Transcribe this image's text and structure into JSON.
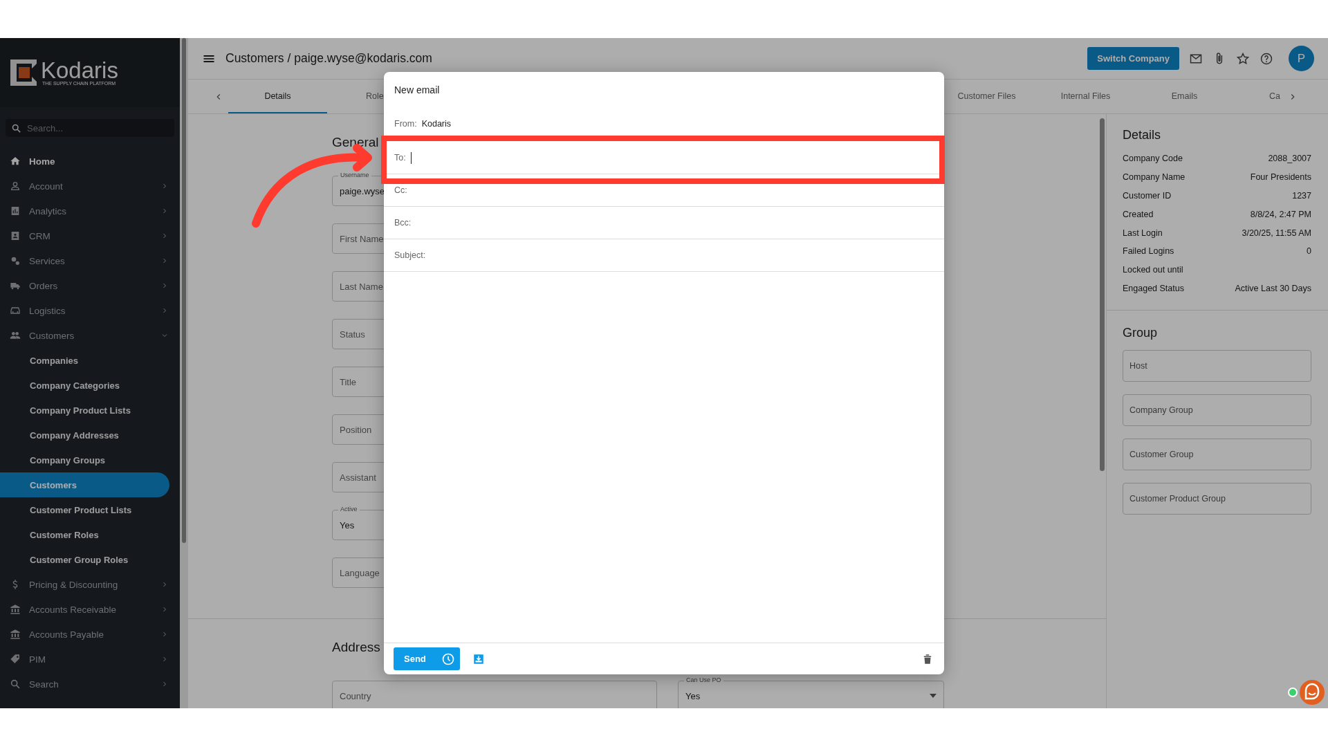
{
  "sidebar": {
    "logo": {
      "name": "Kodaris",
      "tagline": "THE SUPPLY CHAIN PLATFORM"
    },
    "search": {
      "placeholder": "Search..."
    },
    "items": [
      {
        "label": "Home",
        "kind": "link"
      },
      {
        "label": "Account",
        "kind": "group",
        "expanded": false
      },
      {
        "label": "Analytics",
        "kind": "group",
        "expanded": false
      },
      {
        "label": "CRM",
        "kind": "group",
        "expanded": false
      },
      {
        "label": "Services",
        "kind": "group",
        "expanded": false
      },
      {
        "label": "Orders",
        "kind": "group",
        "expanded": false
      },
      {
        "label": "Logistics",
        "kind": "group",
        "expanded": false
      },
      {
        "label": "Customers",
        "kind": "group",
        "expanded": true,
        "children": [
          {
            "label": "Companies",
            "selected": false
          },
          {
            "label": "Company Categories",
            "selected": false
          },
          {
            "label": "Company Product Lists",
            "selected": false
          },
          {
            "label": "Company Addresses",
            "selected": false
          },
          {
            "label": "Company Groups",
            "selected": false
          },
          {
            "label": "Customers",
            "selected": true
          },
          {
            "label": "Customer Product Lists",
            "selected": false
          },
          {
            "label": "Customer Roles",
            "selected": false
          },
          {
            "label": "Customer Group Roles",
            "selected": false
          }
        ]
      },
      {
        "label": "Pricing & Discounting",
        "kind": "group",
        "expanded": false
      },
      {
        "label": "Accounts Receivable",
        "kind": "group",
        "expanded": false
      },
      {
        "label": "Accounts Payable",
        "kind": "group",
        "expanded": false
      },
      {
        "label": "PIM",
        "kind": "group",
        "expanded": false
      },
      {
        "label": "Search",
        "kind": "group",
        "expanded": false
      }
    ]
  },
  "header": {
    "title": "Customers / paige.wyse@kodaris.com",
    "switch_button": "Switch Company",
    "avatar": "P"
  },
  "tabs": [
    {
      "label": "Details",
      "selected": true
    },
    {
      "label": "Role",
      "selected": false
    },
    {
      "label": "Customer Files",
      "selected": false
    },
    {
      "label": "Internal Files",
      "selected": false
    },
    {
      "label": "Emails",
      "selected": false
    },
    {
      "label": "Ca",
      "selected": false
    }
  ],
  "form": {
    "sections": [
      {
        "title": "General",
        "fields": [
          {
            "label": "Username",
            "value": "paige.wyse"
          },
          {
            "placeholder": "First Name"
          },
          {
            "placeholder": "Last Name"
          },
          {
            "placeholder": "Status"
          },
          {
            "placeholder": "Title"
          },
          {
            "placeholder": "Position"
          },
          {
            "placeholder": "Assistant"
          },
          {
            "label": "Active",
            "value": "Yes"
          },
          {
            "placeholder": "Language"
          }
        ]
      },
      {
        "title": "Address",
        "fields": [
          {
            "placeholder": "Country"
          },
          {
            "label": "Can Use PO",
            "value": "Yes",
            "kind": "select"
          }
        ]
      }
    ]
  },
  "details": {
    "title": "Details",
    "rows": [
      {
        "label": "Company Code",
        "value": "2088_3007"
      },
      {
        "label": "Company Name",
        "value": "Four Presidents"
      },
      {
        "label": "Customer ID",
        "value": "1237"
      },
      {
        "label": "Created",
        "value": "8/8/24, 2:47 PM"
      },
      {
        "label": "Last Login",
        "value": "3/20/25, 11:55 AM"
      },
      {
        "label": "Failed Logins",
        "value": "0"
      },
      {
        "label": "Locked out until"
      },
      {
        "label": "Engaged Status",
        "value": "Active Last 30 Days"
      }
    ]
  },
  "group": {
    "title": "Group",
    "fields": [
      {
        "placeholder": "Host"
      },
      {
        "placeholder": "Company Group"
      },
      {
        "placeholder": "Customer Group"
      },
      {
        "placeholder": "Customer Product Group"
      }
    ]
  },
  "email_dialog": {
    "title": "New email",
    "from": {
      "label": "From:",
      "value": "Kodaris"
    },
    "fields": [
      {
        "label": "To:",
        "focused": true
      },
      {
        "label": "Cc:",
        "focused": false
      },
      {
        "label": "Bcc:",
        "focused": false
      },
      {
        "label": "Subject:",
        "focused": false
      }
    ],
    "send_button": "Send"
  }
}
